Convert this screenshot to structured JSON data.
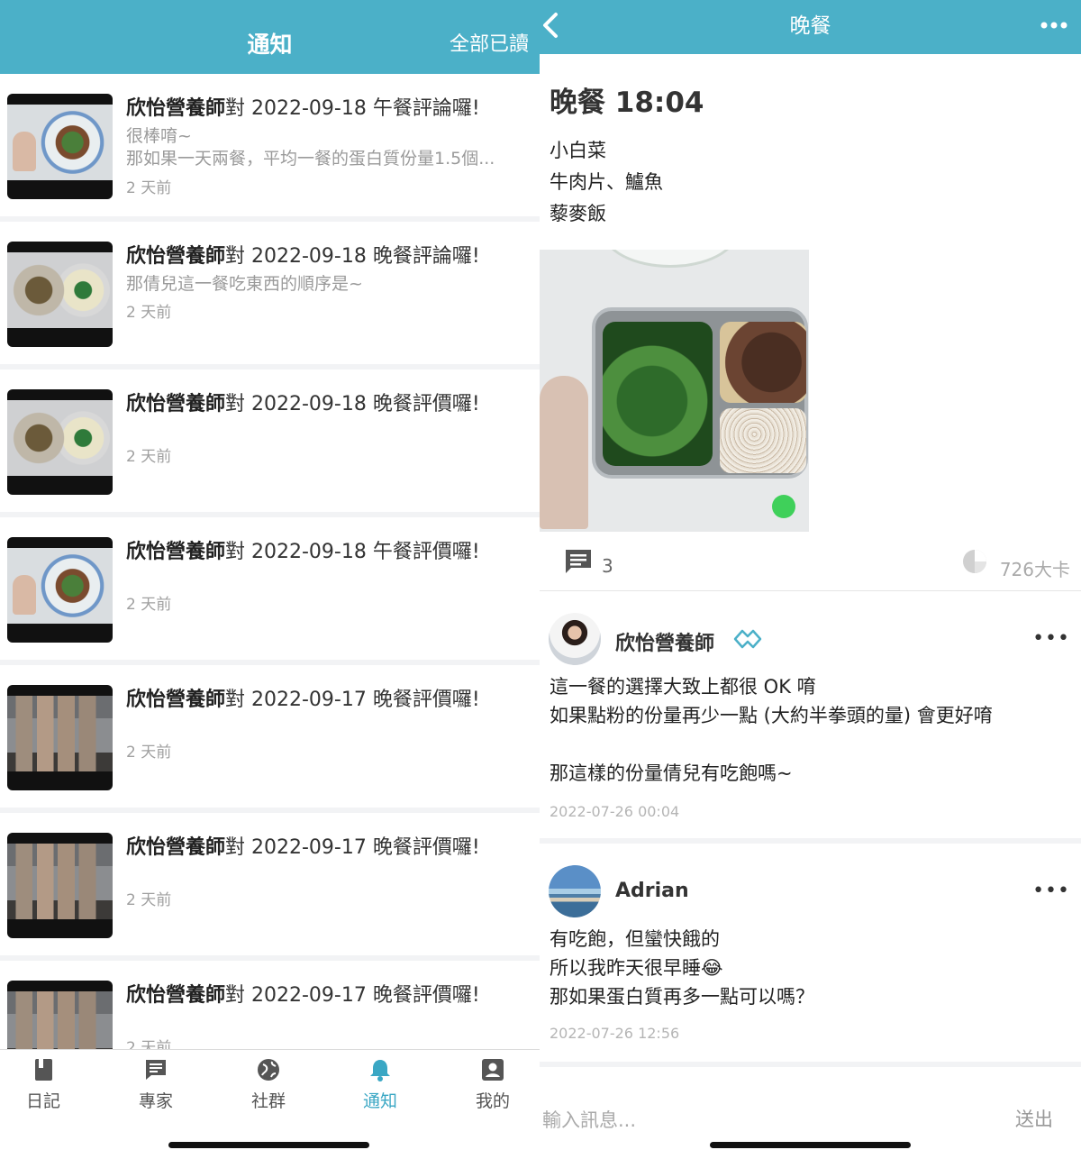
{
  "left": {
    "header": {
      "title": "通知",
      "mark_all_read": "全部已讀"
    },
    "notifications": [
      {
        "author": "欣怡營養師",
        "suffix": "對 2022-09-18 午餐評論囉!",
        "body": [
          "很棒唷~",
          "那如果一天兩餐，平均一餐的蛋白質份量1.5個..."
        ],
        "time": "2 天前"
      },
      {
        "author": "欣怡營養師",
        "suffix": "對 2022-09-18 晚餐評論囉!",
        "body": [
          "那倩兒這一餐吃東西的順序是~"
        ],
        "time": "2 天前"
      },
      {
        "author": "欣怡營養師",
        "suffix": "對 2022-09-18 晚餐評價囉!",
        "body": [],
        "time": "2 天前"
      },
      {
        "author": "欣怡營養師",
        "suffix": "對 2022-09-18 午餐評價囉!",
        "body": [],
        "time": "2 天前"
      },
      {
        "author": "欣怡營養師",
        "suffix": "對 2022-09-17 晚餐評價囉!",
        "body": [],
        "time": "2 天前"
      },
      {
        "author": "欣怡營養師",
        "suffix": "對 2022-09-17 晚餐評價囉!",
        "body": [],
        "time": "2 天前"
      },
      {
        "author": "欣怡營養師",
        "suffix": "對 2022-09-17 晚餐評價囉!",
        "body": [],
        "time": "2 天前"
      }
    ],
    "tabs": [
      {
        "label": "日記",
        "icon": "book-icon"
      },
      {
        "label": "專家",
        "icon": "chat-icon"
      },
      {
        "label": "社群",
        "icon": "globe-icon"
      },
      {
        "label": "通知",
        "icon": "bell-icon",
        "active": true
      },
      {
        "label": "我的",
        "icon": "profile-icon"
      }
    ]
  },
  "right": {
    "header": {
      "title": "晚餐"
    },
    "meal": {
      "title": "晚餐 18:04",
      "foods": [
        "小白菜",
        "牛肉片、鱸魚",
        "藜麥飯"
      ]
    },
    "stats": {
      "comments": "3",
      "calories": "726大卡"
    },
    "comments": [
      {
        "name": "欣怡營養師",
        "lines": [
          "這一餐的選擇大致上都很 OK 唷",
          "如果點粉的份量再少一點 (大約半拳頭的量) 會更好唷",
          "",
          "那這樣的份量倩兒有吃飽嗎~"
        ],
        "date": "2022-07-26 00:04"
      },
      {
        "name": "Adrian",
        "lines": [
          "有吃飽，但蠻快餓的",
          "所以我昨天很早睡😂",
          "那如果蛋白質再多一點可以嗎？"
        ],
        "date": "2022-07-26 12:56"
      }
    ],
    "input": {
      "placeholder": "輸入訊息...",
      "send": "送出"
    }
  },
  "colors": {
    "header": "#4bb0c8",
    "active_tab": "#3aa7c4"
  }
}
